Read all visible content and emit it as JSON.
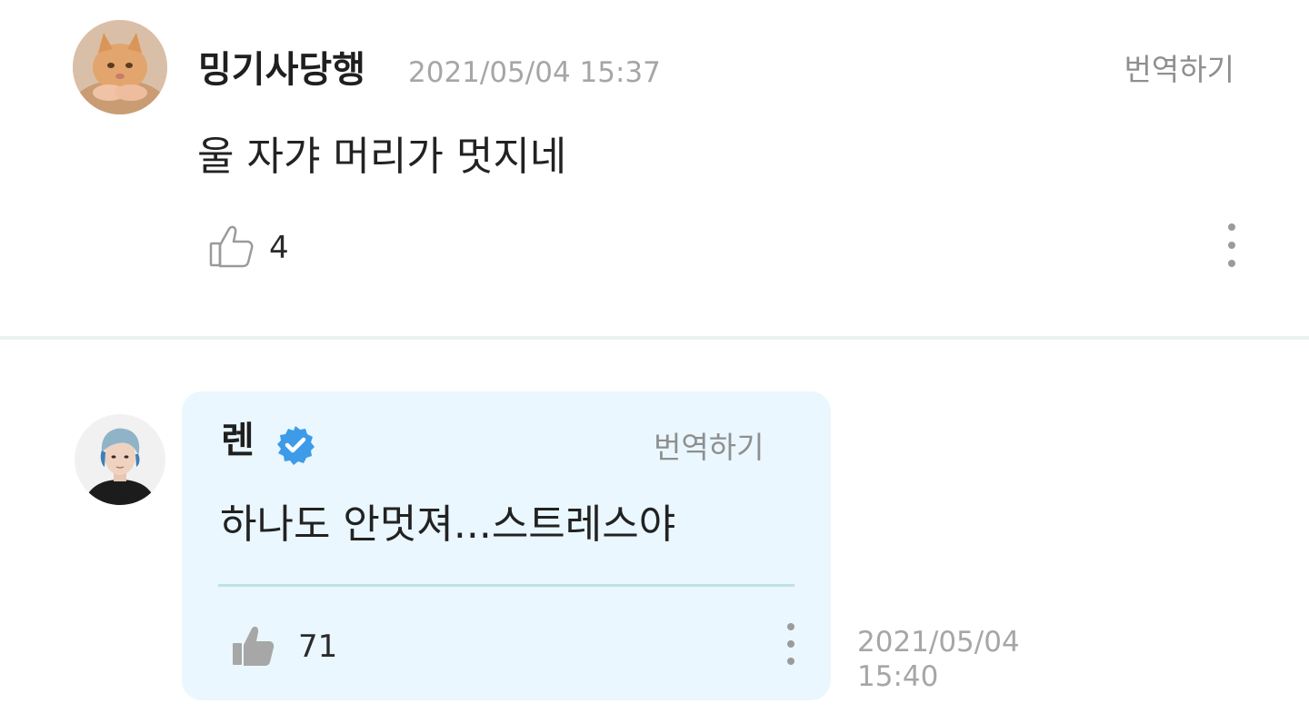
{
  "comments": [
    {
      "author": "밍기사당행",
      "time": "2021/05/04 15:37",
      "translate_label": "번역하기",
      "text": "울 자갸 머리가 멋지네",
      "likes": "4"
    }
  ],
  "reply": {
    "author": "렌",
    "verified": true,
    "translate_label": "번역하기",
    "text": "하나도 안멋져...스트레스야",
    "likes": "71",
    "time": "2021/05/04 15:40"
  },
  "icons": {
    "like_outline": "thumbs-up-outline-icon",
    "like_filled": "thumbs-up-filled-icon",
    "more": "more-vertical-icon",
    "verified": "verified-badge-icon"
  },
  "colors": {
    "bubble_bg": "#eaf7fe",
    "verified_blue": "#3d9be9",
    "meta_gray": "#a6a6a6"
  }
}
